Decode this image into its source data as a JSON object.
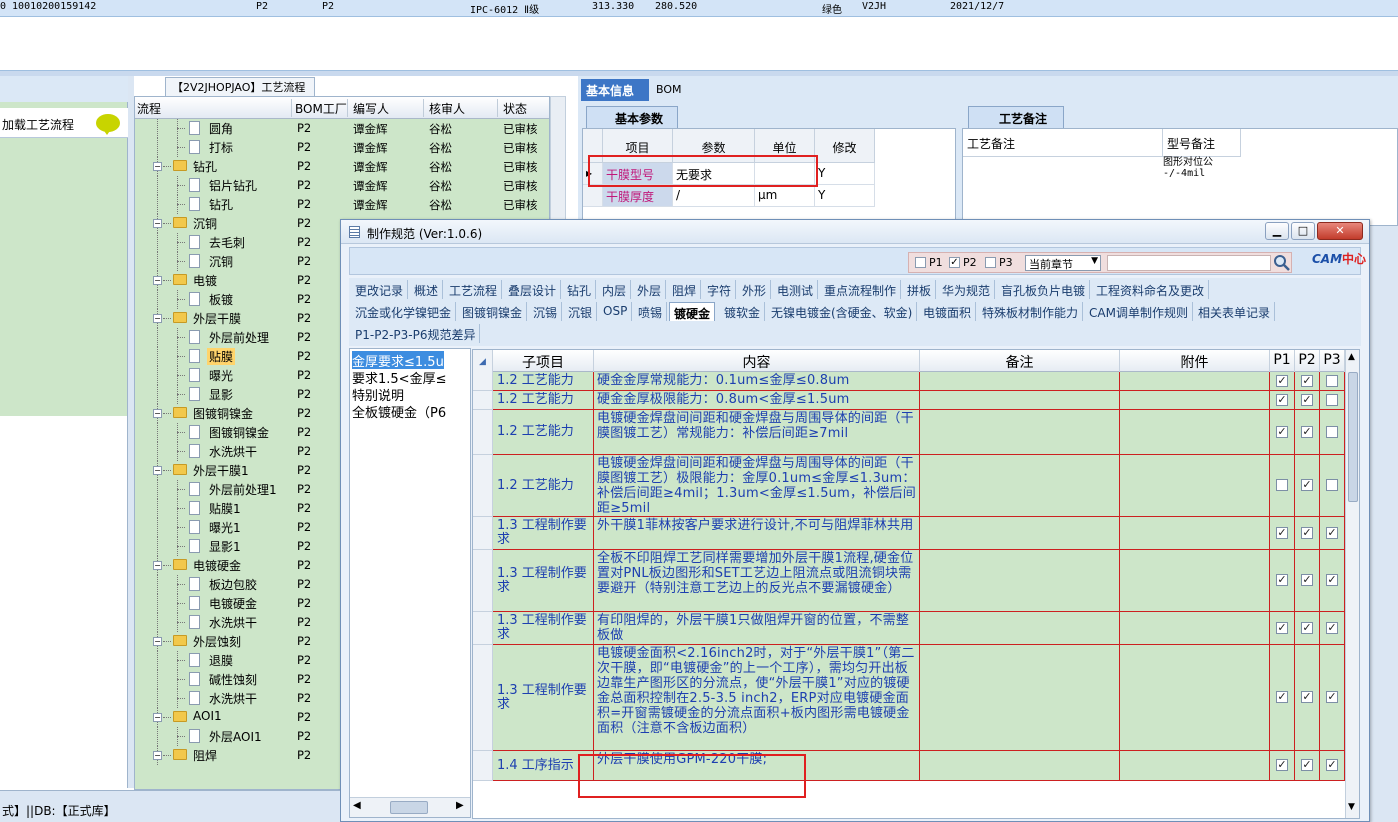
{
  "top_record": {
    "id": "0  10010200159142",
    "layer_a": "P2",
    "layer_b": "P2",
    "standard": "IPC-6012 Ⅱ级",
    "width": "313.330",
    "length": "280.520",
    "color": "绿色",
    "code": "V2JH",
    "date": "2021/12/7"
  },
  "left_panel": {
    "load_flow_label": "加载工艺流程"
  },
  "flow_tab": "【2V2JHOPJAO】工艺流程",
  "tree": {
    "headers": {
      "flow": "流程",
      "bom": "BOM工厂",
      "author": "编写人",
      "reviewer": "核审人",
      "status": "状态"
    },
    "rows": [
      {
        "name": "圆角",
        "bom": "P2",
        "author": "谭金辉",
        "reviewer": "谷松",
        "status": "已审核",
        "level": 2
      },
      {
        "name": "打标",
        "bom": "P2",
        "author": "谭金辉",
        "reviewer": "谷松",
        "status": "已审核",
        "level": 2
      },
      {
        "name": "钻孔",
        "bom": "P2",
        "author": "谭金辉",
        "reviewer": "谷松",
        "status": "已审核",
        "level": 1
      },
      {
        "name": "铝片钻孔",
        "bom": "P2",
        "author": "谭金辉",
        "reviewer": "谷松",
        "status": "已审核",
        "level": 2
      },
      {
        "name": "钻孔",
        "bom": "P2",
        "author": "谭金辉",
        "reviewer": "谷松",
        "status": "已审核",
        "level": 2
      },
      {
        "name": "沉铜",
        "bom": "P2",
        "author": "",
        "reviewer": "",
        "status": "",
        "level": 1
      },
      {
        "name": "去毛刺",
        "bom": "P2",
        "author": "",
        "reviewer": "",
        "status": "",
        "level": 2
      },
      {
        "name": "沉铜",
        "bom": "P2",
        "author": "",
        "reviewer": "",
        "status": "",
        "level": 2
      },
      {
        "name": "电镀",
        "bom": "P2",
        "author": "",
        "reviewer": "",
        "status": "",
        "level": 1
      },
      {
        "name": "板镀",
        "bom": "P2",
        "author": "",
        "reviewer": "",
        "status": "",
        "level": 2
      },
      {
        "name": "外层干膜",
        "bom": "P2",
        "author": "",
        "reviewer": "",
        "status": "",
        "level": 1
      },
      {
        "name": "外层前处理",
        "bom": "P2",
        "author": "",
        "reviewer": "",
        "status": "",
        "level": 2
      },
      {
        "name": "贴膜",
        "bom": "P2",
        "author": "",
        "reviewer": "",
        "status": "",
        "level": 2,
        "selected": true
      },
      {
        "name": "曝光",
        "bom": "P2",
        "author": "",
        "reviewer": "",
        "status": "",
        "level": 2
      },
      {
        "name": "显影",
        "bom": "P2",
        "author": "",
        "reviewer": "",
        "status": "",
        "level": 2
      },
      {
        "name": "图镀铜镍金",
        "bom": "P2",
        "author": "",
        "reviewer": "",
        "status": "",
        "level": 1
      },
      {
        "name": "图镀铜镍金",
        "bom": "P2",
        "author": "",
        "reviewer": "",
        "status": "",
        "level": 2
      },
      {
        "name": "水洗烘干",
        "bom": "P2",
        "author": "",
        "reviewer": "",
        "status": "",
        "level": 2
      },
      {
        "name": "外层干膜1",
        "bom": "P2",
        "author": "",
        "reviewer": "",
        "status": "",
        "level": 1
      },
      {
        "name": "外层前处理1",
        "bom": "P2",
        "author": "",
        "reviewer": "",
        "status": "",
        "level": 2
      },
      {
        "name": "贴膜1",
        "bom": "P2",
        "author": "",
        "reviewer": "",
        "status": "",
        "level": 2
      },
      {
        "name": "曝光1",
        "bom": "P2",
        "author": "",
        "reviewer": "",
        "status": "",
        "level": 2
      },
      {
        "name": "显影1",
        "bom": "P2",
        "author": "",
        "reviewer": "",
        "status": "",
        "level": 2
      },
      {
        "name": "电镀硬金",
        "bom": "P2",
        "author": "",
        "reviewer": "",
        "status": "",
        "level": 1
      },
      {
        "name": "板边包胶",
        "bom": "P2",
        "author": "",
        "reviewer": "",
        "status": "",
        "level": 2
      },
      {
        "name": "电镀硬金",
        "bom": "P2",
        "author": "",
        "reviewer": "",
        "status": "",
        "level": 2
      },
      {
        "name": "水洗烘干",
        "bom": "P2",
        "author": "",
        "reviewer": "",
        "status": "",
        "level": 2
      },
      {
        "name": "外层蚀刻",
        "bom": "P2",
        "author": "",
        "reviewer": "",
        "status": "",
        "level": 1
      },
      {
        "name": "退膜",
        "bom": "P2",
        "author": "",
        "reviewer": "",
        "status": "",
        "level": 2
      },
      {
        "name": "碱性蚀刻",
        "bom": "P2",
        "author": "",
        "reviewer": "",
        "status": "",
        "level": 2
      },
      {
        "name": "水洗烘干",
        "bom": "P2",
        "author": "",
        "reviewer": "",
        "status": "",
        "level": 2
      },
      {
        "name": "AOI1",
        "bom": "P2",
        "author": "",
        "reviewer": "",
        "status": "",
        "level": 1
      },
      {
        "name": "外层AOI1",
        "bom": "P2",
        "author": "",
        "reviewer": "",
        "status": "",
        "level": 2
      },
      {
        "name": "阻焊",
        "bom": "P2",
        "author": "",
        "reviewer": "",
        "status": "",
        "level": 1
      }
    ]
  },
  "info_tabs": {
    "basic": "基本信息",
    "bom": "BOM"
  },
  "basic_params": {
    "tab": "基本参数",
    "headers": [
      "项目",
      "参数",
      "单位",
      "修改"
    ],
    "rows": [
      {
        "name": "干膜型号",
        "value": "无要求",
        "unit": "",
        "edit": "Y"
      },
      {
        "name": "干膜厚度",
        "value": "/",
        "unit": "μm",
        "edit": "Y"
      }
    ]
  },
  "craft_notes": {
    "tab": "工艺备注",
    "headers": [
      "工艺备注",
      "型号备注"
    ],
    "type_note": "图形对位公\n-/-4mil"
  },
  "dialog": {
    "title": "制作规范 (Ver:1.0.6)",
    "filters": [
      {
        "label": "P1",
        "checked": false
      },
      {
        "label": "P2",
        "checked": true
      },
      {
        "label": "P3",
        "checked": false
      }
    ],
    "chapter": "当前章节",
    "search_placeholder": "",
    "logo_main": "CAM",
    "logo_zh": "中心",
    "tabs_row1": [
      "更改记录",
      "概述",
      "工艺流程",
      "叠层设计",
      "钻孔",
      "内层",
      "外层",
      "阻焊",
      "字符",
      "外形",
      "电测试",
      "重点流程制作",
      "拼板",
      "华为规范",
      "盲孔板负片电镀",
      "工程资料命名及更改"
    ],
    "tabs_row2": [
      "沉金或化学镍钯金",
      "图镀铜镍金",
      "沉锡",
      "沉银",
      "OSP",
      "喷锡",
      "镀硬金",
      "镀软金",
      "无镍电镀金(含硬金、软金)",
      "电镀面积",
      "特殊板材制作能力",
      "CAM调单制作规则",
      "相关表单记录"
    ],
    "tabs_row3": [
      "P1-P2-P3-P6规范差异"
    ],
    "active_tab": "镀硬金",
    "list_items": [
      {
        "text": "金厚要求≤1.5u",
        "selected": true
      },
      {
        "text": "要求1.5<金厚≤",
        "selected": false
      },
      {
        "text": "特别说明",
        "selected": false
      },
      {
        "text": "全板镀硬金（P6",
        "selected": false
      }
    ],
    "spec_headers": [
      "子项目",
      "内容",
      "备注",
      "附件",
      "P1",
      "P2",
      "P3"
    ],
    "spec_rows": [
      {
        "sub": "1.2 工艺能力",
        "content": "硬金金厚常规能力：0.1um≤金厚≤0.8um",
        "p": [
          true,
          true,
          false
        ]
      },
      {
        "sub": "1.2 工艺能力",
        "content": "硬金金厚极限能力：0.8um<金厚≤1.5um",
        "p": [
          true,
          true,
          false
        ]
      },
      {
        "sub": "1.2 工艺能力",
        "content": "电镀硬金焊盘间间距和硬金焊盘与周围导体的间距（干膜图镀工艺）常规能力：补偿后间距≥7mil",
        "p": [
          true,
          true,
          false
        ]
      },
      {
        "sub": "1.2 工艺能力",
        "content": "电镀硬金焊盘间间距和硬金焊盘与周围导体的间距（干膜图镀工艺）极限能力：金厚0.1um≤金厚≤1.3um：补偿后间距≥4mil；1.3um<金厚≤1.5um，补偿后间距≥5mil",
        "p": [
          false,
          true,
          false
        ]
      },
      {
        "sub": "1.3 工程制作要求",
        "content": "外干膜1菲林按客户要求进行设计,不可与阻焊菲林共用",
        "p": [
          true,
          true,
          true
        ]
      },
      {
        "sub": "1.3 工程制作要求",
        "content": "全板不印阻焊工艺同样需要增加外层干膜1流程,硬金位置对PNL板边图形和SET工艺边上阻流点或阻流铜块需要避开（特别注意工艺边上的反光点不要漏镀硬金）",
        "p": [
          true,
          true,
          true
        ]
      },
      {
        "sub": "1.3 工程制作要求",
        "content": "有印阻焊的，外层干膜1只做阻焊开窗的位置，不需整板做",
        "p": [
          true,
          true,
          true
        ]
      },
      {
        "sub": "1.3 工程制作要求",
        "content": "电镀硬金面积<2.16inch2时，对于“外层干膜1”（第二次干膜，即“电镀硬金”的上一个工序），需均匀开出板边靠生产图形区的分流点，使“外层干膜1”对应的镀硬金总面积控制在2.5-3.5 inch2，ERP对应电镀硬金面积=开窗需镀硬金的分流点面积+板内图形需电镀硬金面积（注意不含板边面积）",
        "p": [
          true,
          true,
          true
        ]
      },
      {
        "sub": "1.4 工序指示",
        "content": "外层干膜使用GPM-220干膜;",
        "p": [
          true,
          true,
          true
        ]
      }
    ]
  },
  "status_bar": "式】||DB:【正式库】"
}
